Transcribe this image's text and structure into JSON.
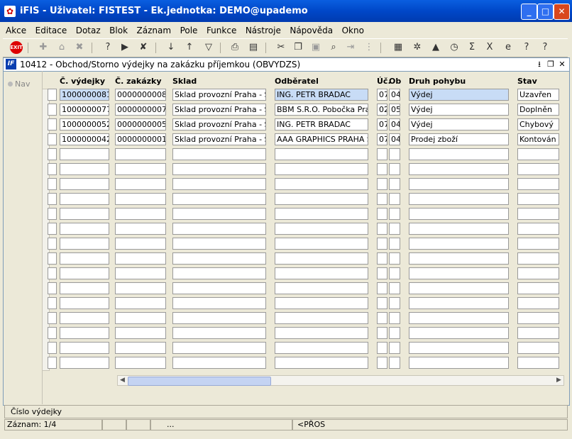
{
  "window": {
    "title": "iFIS - Uživatel: FISTEST - Ek.jednotka: DEMO@upademo"
  },
  "menu": [
    "Akce",
    "Editace",
    "Dotaz",
    "Blok",
    "Záznam",
    "Pole",
    "Funkce",
    "Nástroje",
    "Nápověda",
    "Okno"
  ],
  "toolbar": {
    "exit_label": "EXIT"
  },
  "form": {
    "title": "10412 - Obchod/Storno výdejky na zakázku příjemkou (OBVYDZS)",
    "nav_label": "Nav",
    "columns": [
      "Č. výdejky",
      "Č. zakázky",
      "Sklad",
      "Odběratel",
      "Úč.",
      "Ob",
      "Druh pohybu",
      "Stav"
    ],
    "rows": [
      [
        "1000000081",
        "0000000008",
        "Sklad provozní Praha - Sto",
        "ING. PETR BRADAC",
        "07",
        "04",
        "Výdej",
        "Uzavřen"
      ],
      [
        "1000000077",
        "0000000007",
        "Sklad provozní Praha - Sto",
        "BBM S.R.O. Pobočka Praha",
        "02",
        "05",
        "Výdej",
        "Doplněn"
      ],
      [
        "1000000052",
        "0000000005",
        "Sklad provozní Praha - Sto",
        "ING. PETR BRADAC",
        "07",
        "04",
        "Výdej",
        "Chybový"
      ],
      [
        "1000000042",
        "0000000001",
        "Sklad provozní Praha - Sto",
        "AAA GRAPHICS PRAHA S",
        "07",
        "04",
        "Prodej zboží",
        "Kontován"
      ]
    ]
  },
  "status": {
    "hint": "Číslo výdejky",
    "record": "Záznam: 1/4",
    "dots": "...",
    "mode": "<PŘOS"
  }
}
